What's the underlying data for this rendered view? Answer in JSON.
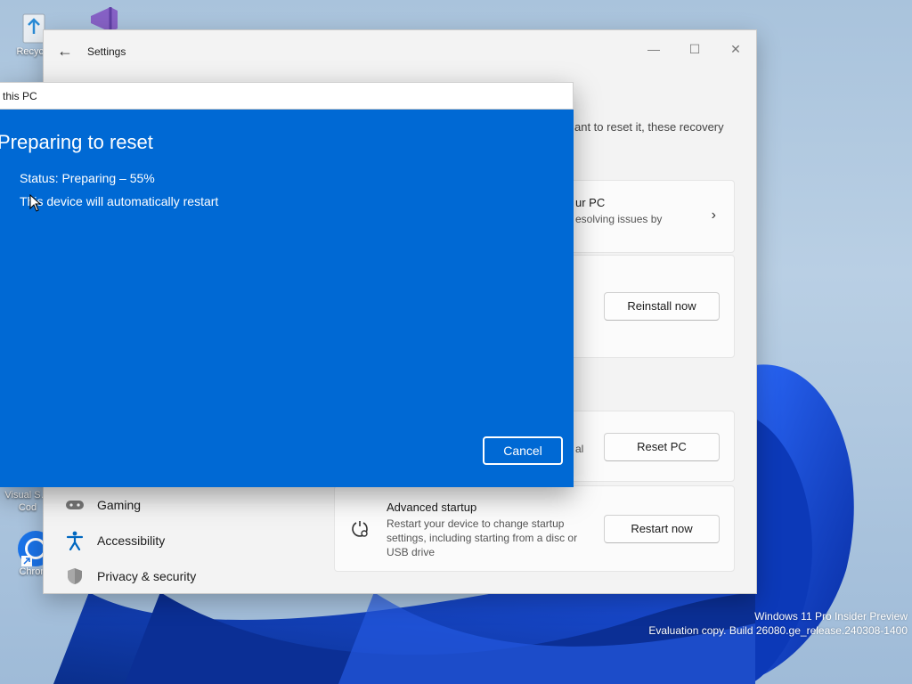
{
  "desktop": {
    "icons": [
      {
        "label": "Recycle",
        "icon": "recycle-bin-icon"
      },
      {
        "label": "",
        "icon": "visual-studio-icon"
      },
      {
        "label": "Visual S… Cod",
        "icon": "vscode-icon"
      },
      {
        "label": "Chrom",
        "icon": "chrome-icon"
      }
    ],
    "watermark": {
      "line1": "Windows 11 Pro Insider Preview",
      "line2": "Evaluation copy. Build 26080.ge_release.240308-1400"
    }
  },
  "settings": {
    "title": "Settings",
    "back_glyph": "←",
    "controls": {
      "minimize": "—",
      "maximize": "☐",
      "close": "✕"
    },
    "intro_fragment": "ant to reset it, these recovery",
    "cards": {
      "fix_problems": {
        "title_fragment": "ur PC",
        "subtitle_fragment": "esolving issues by",
        "chevron": "›"
      },
      "reinstall": {
        "button": "Reinstall now"
      },
      "reset": {
        "subtitle_fragment": "al",
        "button": "Reset PC"
      },
      "advanced_startup": {
        "title": "Advanced startup",
        "subtitle_line1": "Restart your device to change startup",
        "subtitle_line2": "settings, including starting from a disc or",
        "subtitle_line3": "USB drive",
        "button": "Restart now"
      }
    },
    "nav": [
      {
        "label": "Gaming",
        "icon": "gamepad-icon"
      },
      {
        "label": "Accessibility",
        "icon": "accessibility-icon"
      },
      {
        "label": "Privacy & security",
        "icon": "shield-icon"
      }
    ]
  },
  "reset_dialog": {
    "title_fragment": "this PC",
    "heading": "Preparing to reset",
    "status": "Status: Preparing – 55%",
    "progress_percent": 55,
    "note": "This device will automatically restart",
    "cancel": "Cancel",
    "colors": {
      "background": "#0069d4"
    }
  }
}
